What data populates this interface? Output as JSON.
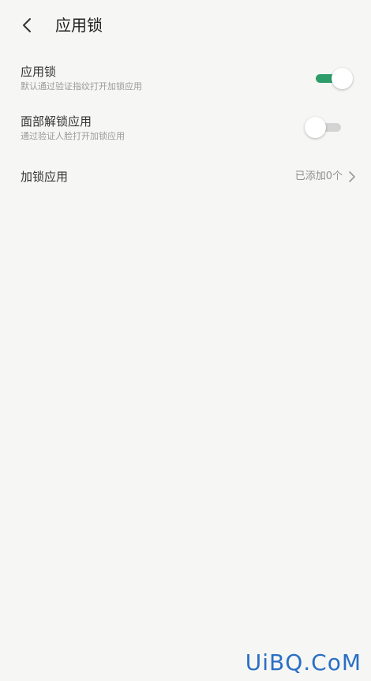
{
  "header": {
    "title": "应用锁",
    "back_icon": "chevron-left-icon"
  },
  "settings": {
    "app_lock": {
      "title": "应用锁",
      "subtitle": "默认通过验证指纹打开加锁应用",
      "enabled": true
    },
    "face_unlock": {
      "title": "面部解锁应用",
      "subtitle": "通过验证人脸打开加锁应用",
      "enabled": false
    },
    "locked_apps": {
      "title": "加锁应用",
      "value": "已添加0个",
      "icon": "chevron-right-icon"
    }
  },
  "watermark": "UiBQ.CoM",
  "colors": {
    "background": "#f6f7f5",
    "toggle_on": "#2f9d6a",
    "toggle_off": "#d4d4d4",
    "watermark": "#2a6fc4"
  }
}
